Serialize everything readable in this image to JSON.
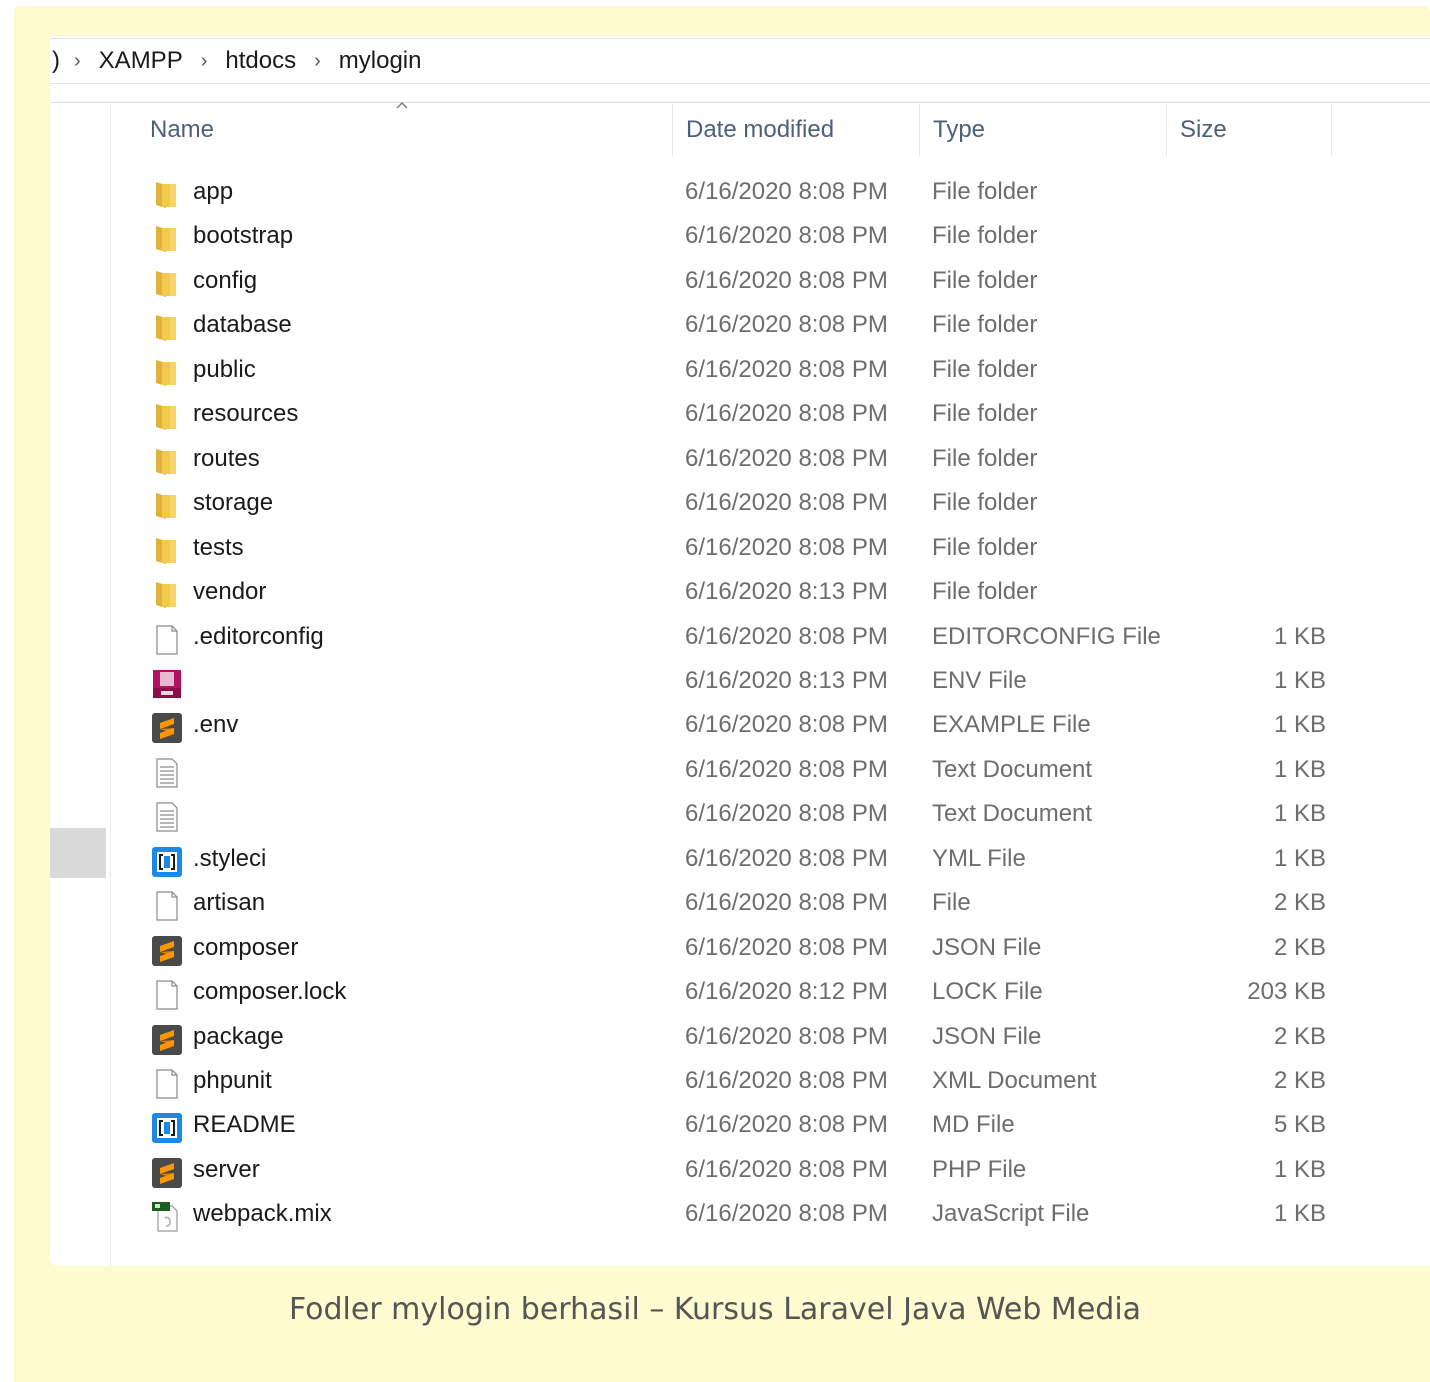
{
  "breadcrumb": {
    "lead": ")",
    "items": [
      "XAMPP",
      "htdocs",
      "mylogin"
    ]
  },
  "columns": {
    "name": "Name",
    "date": "Date modified",
    "type": "Type",
    "size": "Size"
  },
  "colors": {
    "frame_background": "#fdfbcf",
    "folder": "#f2c94c",
    "sublime": "#ff9800",
    "vscode": "#1e88e5"
  },
  "files": [
    {
      "icon": "folder-icon",
      "name": "app",
      "date": "6/16/2020 8:08 PM",
      "type": "File folder",
      "size": ""
    },
    {
      "icon": "folder-icon",
      "name": "bootstrap",
      "date": "6/16/2020 8:08 PM",
      "type": "File folder",
      "size": ""
    },
    {
      "icon": "folder-icon",
      "name": "config",
      "date": "6/16/2020 8:08 PM",
      "type": "File folder",
      "size": ""
    },
    {
      "icon": "folder-icon",
      "name": "database",
      "date": "6/16/2020 8:08 PM",
      "type": "File folder",
      "size": ""
    },
    {
      "icon": "folder-icon",
      "name": "public",
      "date": "6/16/2020 8:08 PM",
      "type": "File folder",
      "size": ""
    },
    {
      "icon": "folder-icon",
      "name": "resources",
      "date": "6/16/2020 8:08 PM",
      "type": "File folder",
      "size": ""
    },
    {
      "icon": "folder-icon",
      "name": "routes",
      "date": "6/16/2020 8:08 PM",
      "type": "File folder",
      "size": ""
    },
    {
      "icon": "folder-icon",
      "name": "storage",
      "date": "6/16/2020 8:08 PM",
      "type": "File folder",
      "size": ""
    },
    {
      "icon": "folder-icon",
      "name": "tests",
      "date": "6/16/2020 8:08 PM",
      "type": "File folder",
      "size": ""
    },
    {
      "icon": "folder-icon",
      "name": "vendor",
      "date": "6/16/2020 8:13 PM",
      "type": "File folder",
      "size": ""
    },
    {
      "icon": "blank-file-icon",
      "name": ".editorconfig",
      "date": "6/16/2020 8:08 PM",
      "type": "EDITORCONFIG File",
      "size": "1 KB"
    },
    {
      "icon": "env-file-icon",
      "name": "",
      "date": "6/16/2020 8:13 PM",
      "type": "ENV File",
      "size": "1 KB"
    },
    {
      "icon": "sublime-icon",
      "name": ".env",
      "date": "6/16/2020 8:08 PM",
      "type": "EXAMPLE File",
      "size": "1 KB"
    },
    {
      "icon": "text-document-icon",
      "name": "",
      "date": "6/16/2020 8:08 PM",
      "type": "Text Document",
      "size": "1 KB"
    },
    {
      "icon": "text-document-icon",
      "name": "",
      "date": "6/16/2020 8:08 PM",
      "type": "Text Document",
      "size": "1 KB"
    },
    {
      "icon": "vscode-icon",
      "name": ".styleci",
      "date": "6/16/2020 8:08 PM",
      "type": "YML File",
      "size": "1 KB"
    },
    {
      "icon": "blank-file-icon",
      "name": "artisan",
      "date": "6/16/2020 8:08 PM",
      "type": "File",
      "size": "2 KB"
    },
    {
      "icon": "sublime-icon",
      "name": "composer",
      "date": "6/16/2020 8:08 PM",
      "type": "JSON File",
      "size": "2 KB"
    },
    {
      "icon": "blank-file-icon",
      "name": "composer.lock",
      "date": "6/16/2020 8:12 PM",
      "type": "LOCK File",
      "size": "203 KB"
    },
    {
      "icon": "sublime-icon",
      "name": "package",
      "date": "6/16/2020 8:08 PM",
      "type": "JSON File",
      "size": "2 KB"
    },
    {
      "icon": "blank-file-icon",
      "name": "phpunit",
      "date": "6/16/2020 8:08 PM",
      "type": "XML Document",
      "size": "2 KB"
    },
    {
      "icon": "vscode-icon",
      "name": "README",
      "date": "6/16/2020 8:08 PM",
      "type": "MD File",
      "size": "5 KB"
    },
    {
      "icon": "sublime-icon",
      "name": "server",
      "date": "6/16/2020 8:08 PM",
      "type": "PHP File",
      "size": "1 KB"
    },
    {
      "icon": "js-file-icon",
      "name": "webpack.mix",
      "date": "6/16/2020 8:08 PM",
      "type": "JavaScript File",
      "size": "1 KB"
    }
  ],
  "caption": "Fodler mylogin berhasil – Kursus Laravel Java Web Media"
}
